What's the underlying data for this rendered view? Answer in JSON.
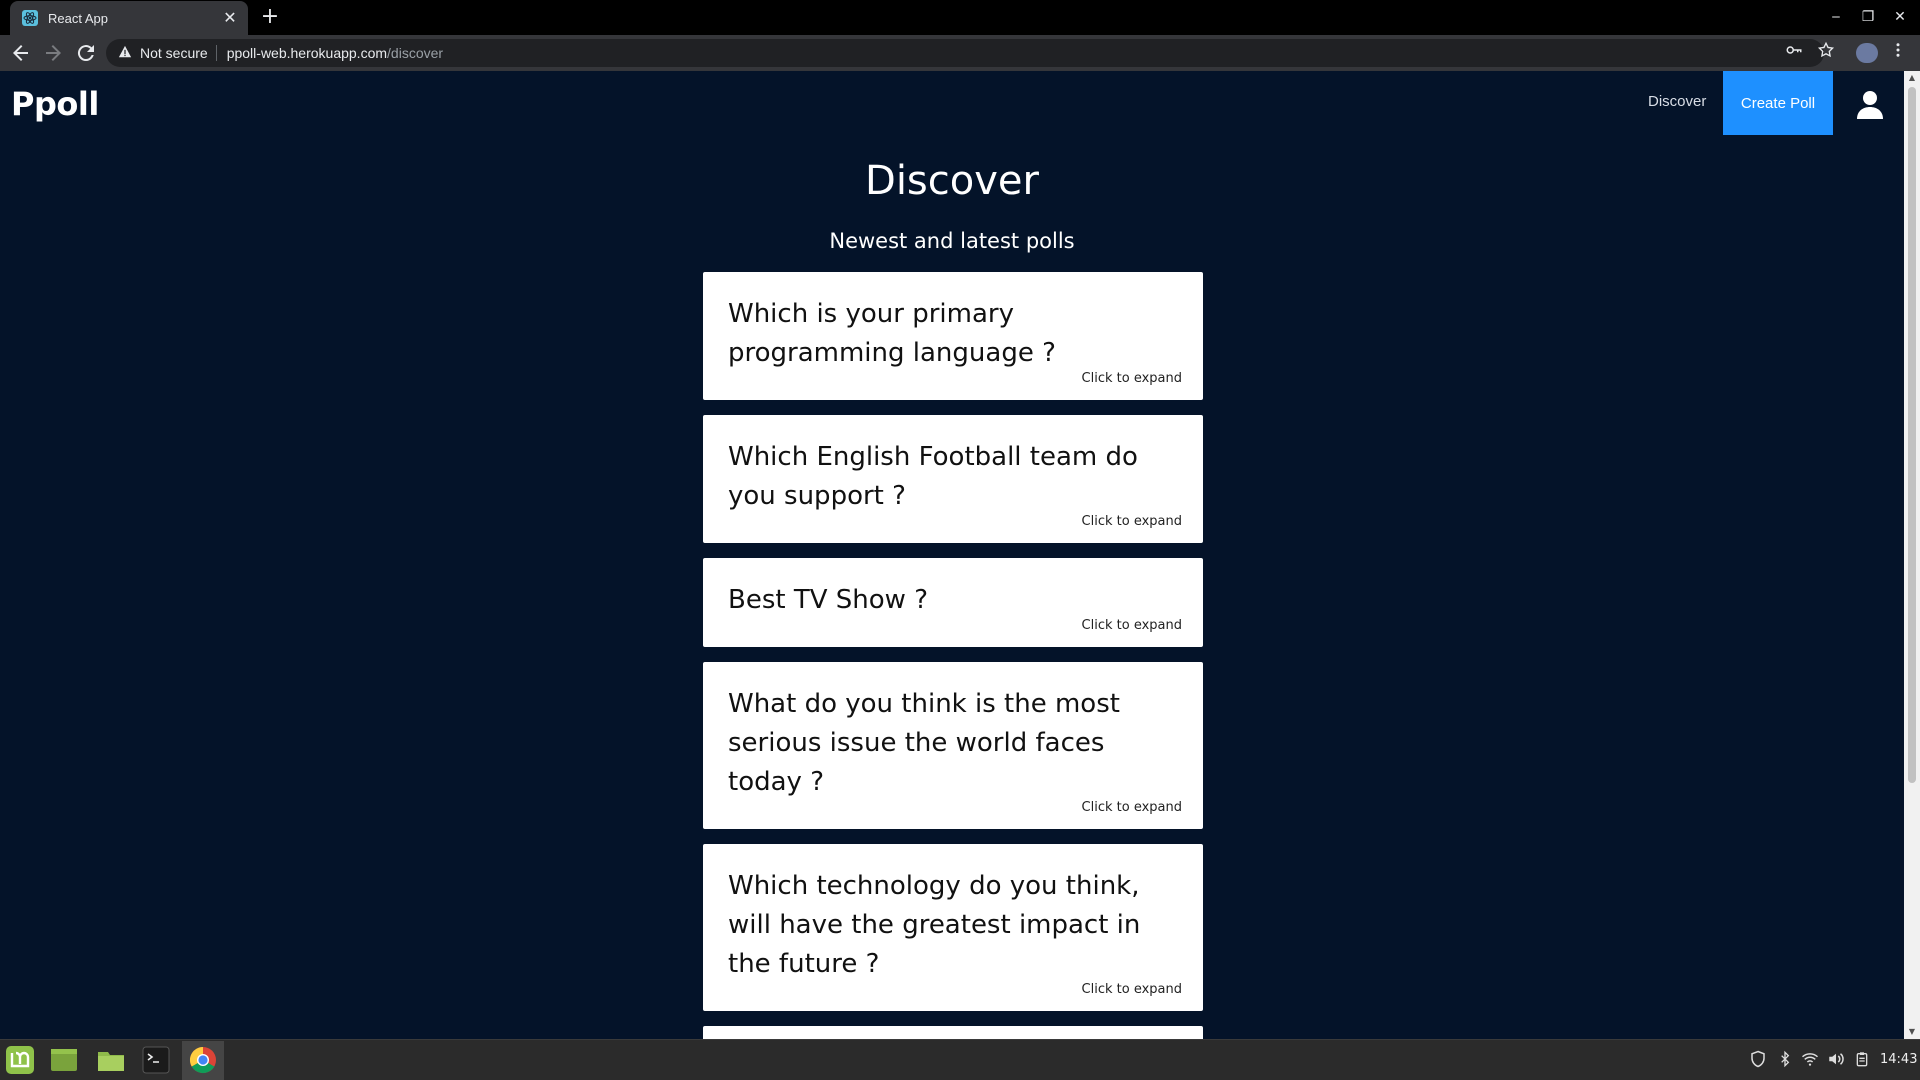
{
  "browser": {
    "tab_title": "React App",
    "tab_close": "✕",
    "new_tab": "+",
    "security_label": "Not secure",
    "url_host": "ppoll-web.herokuapp.com",
    "url_path": "/discover",
    "icons": {
      "back": "back-arrow-icon",
      "forward": "forward-arrow-icon",
      "reload": "reload-icon",
      "key": "key-icon",
      "star": "star-icon",
      "menu": "kebab-menu-icon"
    }
  },
  "window_controls": {
    "minimize": "‒",
    "restore": "❐",
    "close": "✕"
  },
  "app": {
    "logo": "Ppoll",
    "nav": {
      "discover": "Discover",
      "create_poll": "Create Poll"
    },
    "title": "Discover",
    "subtitle": "Newest and latest polls",
    "polls": [
      {
        "question": "Which is your primary programming language ?",
        "hint": "Click to expand"
      },
      {
        "question": "Which English Football team do you support ?",
        "hint": "Click to expand"
      },
      {
        "question": "Best TV Show ?",
        "hint": "Click to expand"
      },
      {
        "question": "What do you think is the most serious issue the world faces today ?",
        "hint": "Click to expand"
      },
      {
        "question": "Which technology do you think, will have the greatest impact in the future ?",
        "hint": "Click to expand"
      }
    ]
  },
  "colors": {
    "page_bg": "#041329",
    "accent": "#1e90ff",
    "card_bg": "#ffffff"
  },
  "taskbar": {
    "apps": [
      "linux-mint-menu-icon",
      "show-desktop-icon",
      "file-manager-icon",
      "terminal-icon",
      "chrome-icon"
    ],
    "tray": [
      "shield-icon",
      "bluetooth-icon",
      "wifi-icon",
      "volume-icon",
      "clipboard-icon"
    ],
    "time": "14:43"
  }
}
